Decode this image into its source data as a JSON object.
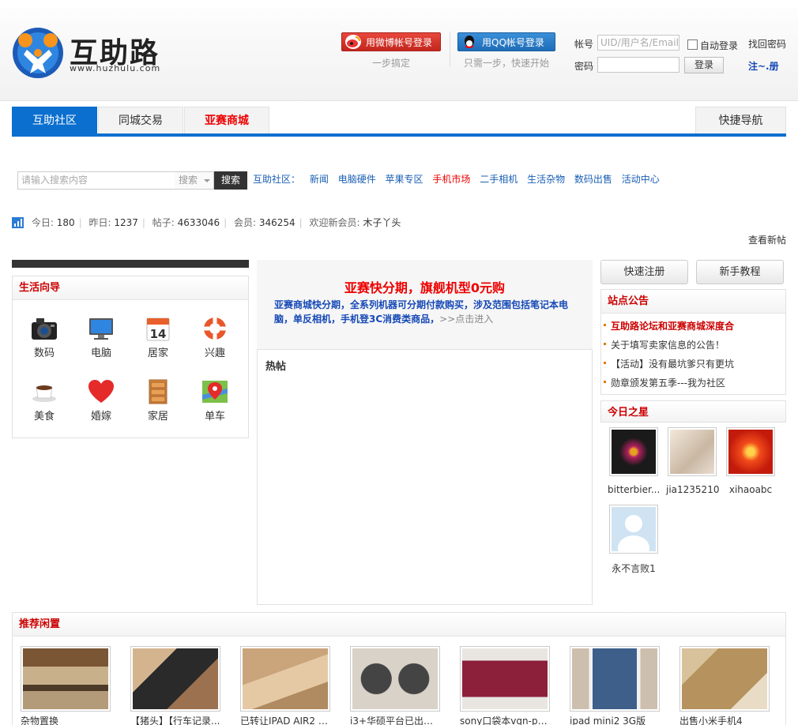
{
  "header": {
    "logo_text": "互助路",
    "logo_url": "www.huzhulu.com",
    "weibo_login": "用微博帐号登录",
    "weibo_hint": "一步搞定",
    "qq_login": "用QQ帐号登录",
    "qq_hint": "只需一步，快速开始",
    "account_label": "帐号",
    "account_placeholder": "UID/用户名/Email",
    "auto_login": "自动登录",
    "find_password": "找回密码",
    "password_label": "密码",
    "login_button": "登录",
    "register_link": "注~.册"
  },
  "nav": {
    "tabs": [
      {
        "label": "互助社区"
      },
      {
        "label": "同城交易"
      },
      {
        "label": "亚赛商城"
      }
    ],
    "quick_nav": "快捷导航"
  },
  "search": {
    "placeholder": "请输入搜索内容",
    "type": "搜索",
    "button": "搜索",
    "links_title": "互助社区：",
    "links": [
      "新闻",
      "电脑硬件",
      "苹果专区",
      "手机市场",
      "二手相机",
      "生活杂物",
      "数码出售",
      "活动中心"
    ]
  },
  "stats": {
    "today_label": "今日:",
    "today": "180",
    "yesterday_label": "昨日:",
    "yesterday": "1237",
    "posts_label": "帖子:",
    "posts": "4633046",
    "members_label": "会员:",
    "members": "346254",
    "welcome_label": "欢迎新会员:",
    "new_member": "木子丫头",
    "view_new": "查看新帖"
  },
  "life_guide": {
    "title": "生活向导",
    "items": [
      {
        "label": "数码",
        "icon": "camera-icon"
      },
      {
        "label": "电脑",
        "icon": "monitor-icon"
      },
      {
        "label": "居家",
        "icon": "calendar-icon"
      },
      {
        "label": "兴趣",
        "icon": "lifebuoy-icon"
      },
      {
        "label": "美食",
        "icon": "coffee-icon"
      },
      {
        "label": "婚嫁",
        "icon": "heart-icon"
      },
      {
        "label": "家居",
        "icon": "cabinet-icon"
      },
      {
        "label": "单车",
        "icon": "map-pin-icon"
      }
    ],
    "calendar_number": "14"
  },
  "promo": {
    "title": "亚赛快分期，旗舰机型0元购",
    "text": "亚赛商城快分期，全系列机器可分期付款购买，涉及范围包括笔记本电脑，单反相机，手机登3C消费类商品，",
    "more": ">>点击进入"
  },
  "hot": {
    "title": "热帖"
  },
  "right": {
    "register": "快速注册",
    "tutorial": "新手教程",
    "notice_title": "站点公告",
    "notices": [
      "互助路论坛和亚赛商城深度合",
      "关于填写卖家信息的公告！",
      "【活动】没有最坑爹只有更坑",
      "勋章颁发第五季---我为社区"
    ],
    "star_title": "今日之星",
    "users": [
      {
        "name": "bitterbier..."
      },
      {
        "name": "jia1235210"
      },
      {
        "name": "xihaoabc"
      },
      {
        "name": "永不言败1"
      }
    ]
  },
  "recommend": {
    "title": "推荐闲置",
    "items": [
      {
        "caption": "杂物置换"
      },
      {
        "caption": "【猪头】【行车记录..."
      },
      {
        "caption": "已转让IPAD AIR2 16..."
      },
      {
        "caption": "i3+华硕平台已出，..."
      },
      {
        "caption": "sony口袋本vgn-p37j"
      },
      {
        "caption": "ipad mini2 3G版"
      },
      {
        "caption": "出售小米手机4"
      }
    ]
  },
  "colors": {
    "brand_blue": "#0a6fcf",
    "accent_red": "#e00000",
    "link_blue": "#1a5fb4"
  }
}
